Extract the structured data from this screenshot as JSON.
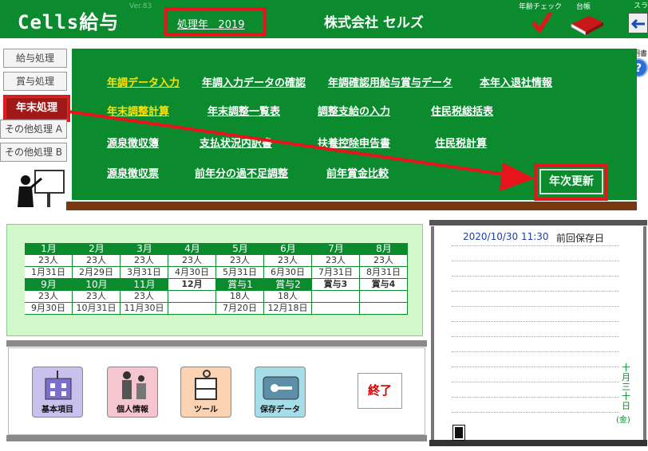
{
  "header": {
    "title": "Cells給与",
    "version": "Ver.83",
    "year_label": "処理年",
    "year": "2019",
    "company": "株式会社 セルズ",
    "check_label": "年齢チェック",
    "ledger_label": "台帳",
    "slide_label": "スライド",
    "manual_label": "説明書"
  },
  "sidebar": {
    "tabs": [
      "給与処理",
      "賞与処理",
      "年末処理",
      "その他処理 A",
      "その他処理 B"
    ]
  },
  "menu": {
    "rows": [
      [
        "年調データ入力",
        "年調入力データの確認",
        "年調確認用給与賞与データ",
        "本年入退社情報"
      ],
      [
        "年末調整計算",
        "年末調整一覧表",
        "調整支給の入力",
        "住民税総括表"
      ],
      [
        "源泉徴収簿",
        "支払状況内訳書",
        "扶養控除申告書",
        "住民税計算"
      ],
      [
        "源泉徴収票",
        "前年分の過不足調整",
        "前年賞金比較"
      ]
    ],
    "annual_update": "年次更新"
  },
  "calendar": {
    "row1_headers": [
      "1月",
      "2月",
      "3月",
      "4月",
      "5月",
      "6月",
      "7月",
      "8月"
    ],
    "row1_counts": [
      "23人",
      "23人",
      "23人",
      "23人",
      "23人",
      "23人",
      "23人",
      "23人"
    ],
    "row1_dates": [
      "1月31日",
      "2月29日",
      "3月31日",
      "4月30日",
      "5月31日",
      "6月30日",
      "7月31日",
      "8月31日"
    ],
    "row2_headers": [
      "9月",
      "10月",
      "11月",
      "12月",
      "賞与1",
      "賞与2",
      "賞与3",
      "賞与4"
    ],
    "row2_counts": [
      "23人",
      "23人",
      "23人",
      "",
      "18人",
      "18人",
      "",
      ""
    ],
    "row2_dates": [
      "9月30日",
      "10月31日",
      "11月30日",
      "",
      "7月20日",
      "12月18日",
      "",
      ""
    ]
  },
  "buttons": {
    "basic": "基本項目",
    "personal": "個人情報",
    "tool": "ツール",
    "save": "保存データ",
    "quit": "終了"
  },
  "notebook": {
    "saved_at": "2020/10/30 11:30",
    "saved_label": "前回保存日",
    "date_vertical": "十月三十日",
    "weekday": "(金)"
  }
}
